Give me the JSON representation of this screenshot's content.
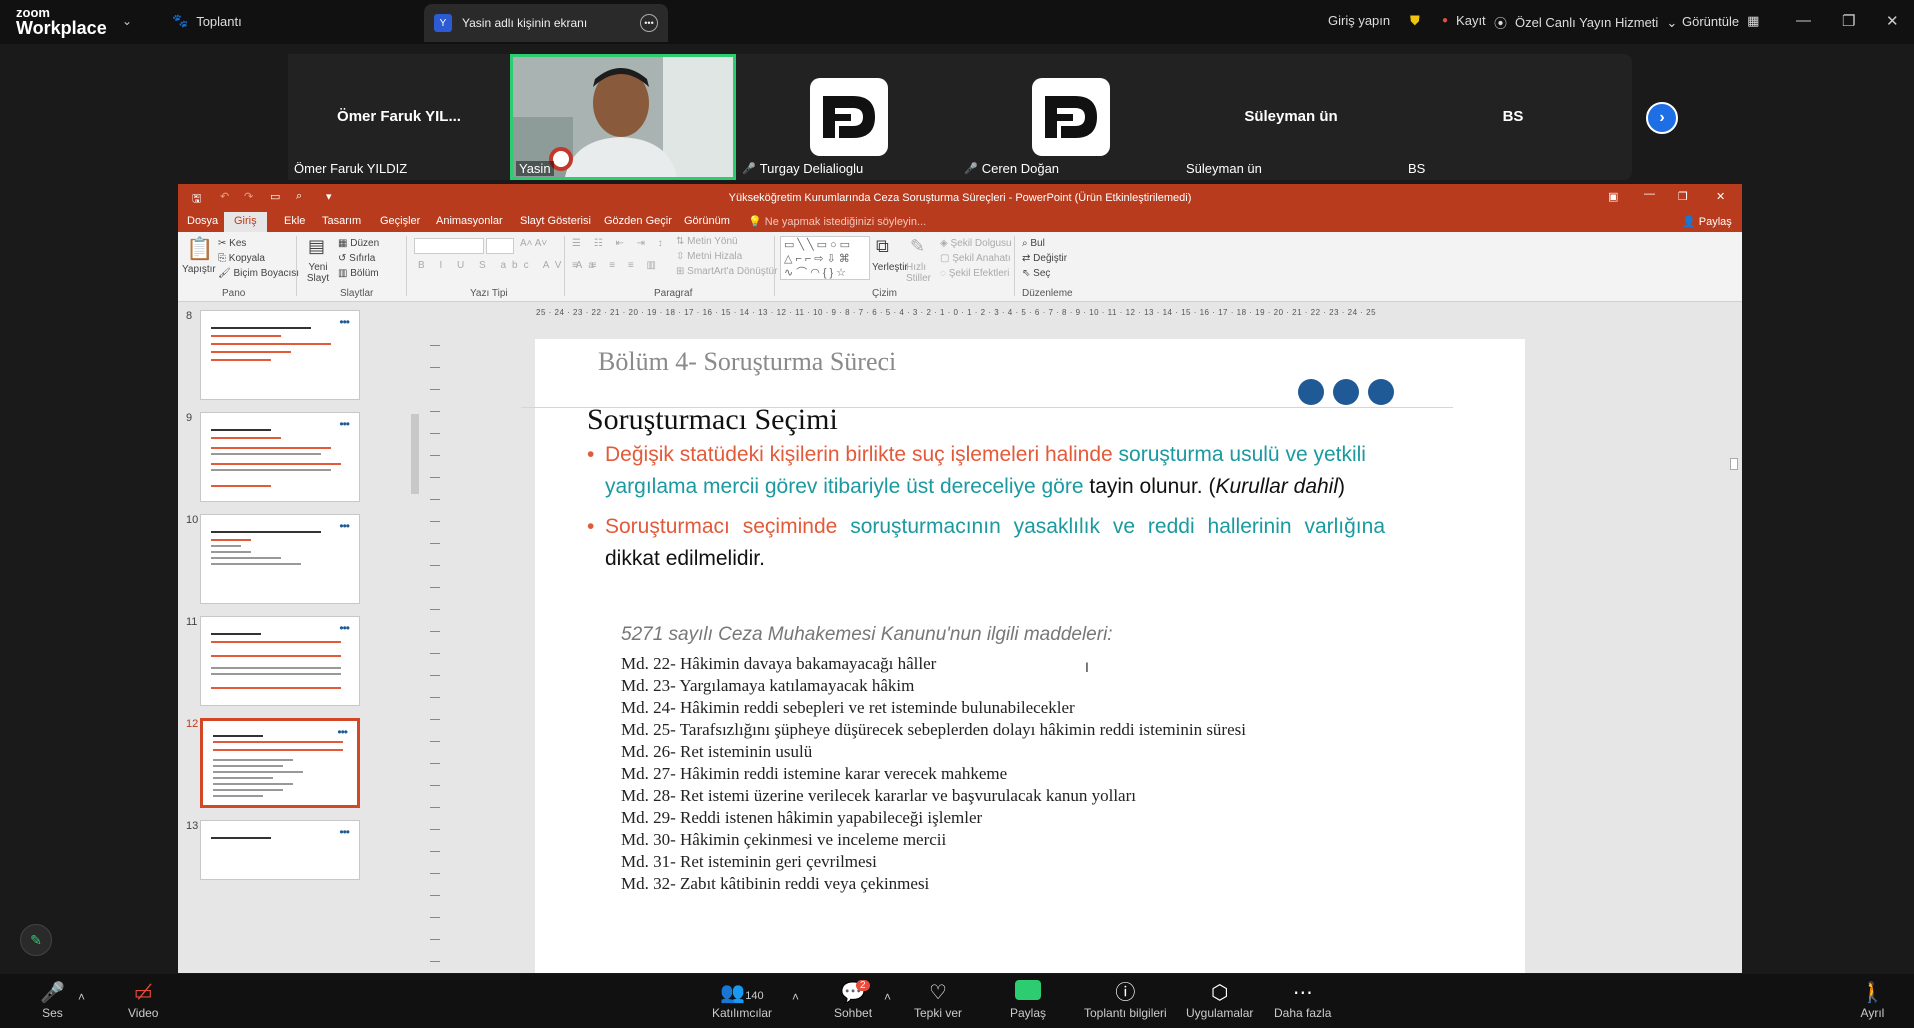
{
  "topbar": {
    "brand_top": "zoom",
    "brand_bottom": "Workplace",
    "meeting_label": "Toplantı",
    "screen_tab_letter": "Y",
    "screen_tab_label": "Yasin adlı kişinin ekranı",
    "login": "Giriş yapın",
    "record": "Kayıt",
    "live": "Özel Canlı Yayın Hizmeti",
    "view": "Görüntüle"
  },
  "gallery": [
    {
      "center": "Ömer Faruk YIL...",
      "bottom": "Ömer Faruk YILDIZ",
      "type": "name",
      "muted": false
    },
    {
      "center": "",
      "bottom": "Yasin",
      "type": "video",
      "muted": false
    },
    {
      "center": "",
      "bottom": "Turgay Delialioglu",
      "type": "logo",
      "muted": true
    },
    {
      "center": "",
      "bottom": "Ceren Doğan",
      "type": "logo",
      "muted": true
    },
    {
      "center": "Süleyman ün",
      "bottom": "Süleyman ün",
      "type": "name",
      "muted": false
    },
    {
      "center": "BS",
      "bottom": "BS",
      "type": "name",
      "muted": false
    }
  ],
  "ppt": {
    "window_title": "Yükseköğretim Kurumlarında Ceza Soruşturma Süreçleri - PowerPoint (Ürün Etkinleştirilemedi)",
    "tabs": [
      "Dosya",
      "Giriş",
      "Ekle",
      "Tasarım",
      "Geçişler",
      "Animasyonlar",
      "Slayt Gösterisi",
      "Gözden Geçir",
      "Görünüm"
    ],
    "tell_me": "Ne yapmak istediğinizi söyleyin...",
    "share": "Paylaş",
    "ribbon": {
      "paste": "Yapıştır",
      "cut": "Kes",
      "copy": "Kopyala",
      "format_painter": "Biçim Boyacısı",
      "clipboard": "Pano",
      "new_slide": "Yeni Slayt",
      "layout": "Düzen",
      "reset": "Sıfırla",
      "section": "Bölüm",
      "slides": "Slaytlar",
      "font_group": "Yazı Tipi",
      "text_direction": "Metin Yönü",
      "align_text": "Metni Hizala",
      "smartart": "SmartArt'a Dönüştür",
      "paragraph": "Paragraf",
      "arrange": "Yerleştir",
      "quick_styles": "Hızlı Stiller",
      "shape_fill": "Şekil Dolgusu",
      "shape_outline": "Şekil Anahatı",
      "shape_effects": "Şekil Efektleri",
      "drawing": "Çizim",
      "find": "Bul",
      "replace": "Değiştir",
      "select": "Seç",
      "editing": "Düzenleme"
    },
    "ruler": "25 · 24 · 23 · 22 · 21 · 20 · 19 · 18 · 17 · 16 · 15 · 14 · 13 · 12 · 11 · 10 · 9 · 8 · 7 · 6 · 5 · 4 · 3 · 2 · 1 · 0 · 1 · 2 · 3 · 4 · 5 · 6 · 7 · 8 · 9 · 10 · 11 · 12 · 13 · 14 · 15 · 16 · 17 · 18 · 19 · 20 · 21 · 22 · 23 · 24 · 25",
    "thumbnails": [
      {
        "num": "8",
        "selected": false
      },
      {
        "num": "9",
        "selected": false
      },
      {
        "num": "10",
        "selected": false
      },
      {
        "num": "11",
        "selected": false
      },
      {
        "num": "12",
        "selected": true
      },
      {
        "num": "13",
        "selected": false
      }
    ]
  },
  "slide": {
    "header": "Bölüm 4- Soruşturma Süreci",
    "title": "Soruşturmacı Seçimi",
    "b1_red": "Değişik statüdeki kişilerin birlikte suç işlemeleri halinde ",
    "b1_teal": "soruşturma usulü ve yetkili yargılama mercii görev itibariyle üst dereceliye göre",
    "b1_black": " tayin olunur. (",
    "b1_italic": "Kurullar dahil",
    "b1_end": ")",
    "b2_red": "Soruşturmacı seçiminde ",
    "b2_teal": "soruşturmacının yasaklılık ve reddi hallerinin varlığına",
    "b2_black": " dikkat edilmelidir.",
    "law_heading": "5271 sayılı Ceza Muhakemesi Kanunu'nun ilgili maddeleri:",
    "articles": [
      "Md. 22- Hâkimin davaya bakamayacağı hâller",
      "Md. 23- Yargılamaya katılamayacak hâkim",
      "Md. 24- Hâkimin reddi sebepleri ve ret isteminde bulunabilecekler",
      "Md. 25- Tarafsızlığını şüpheye düşürecek sebeplerden dolayı hâkimin reddi isteminin süresi",
      "Md. 26- Ret isteminin usulü",
      "Md. 27- Hâkimin reddi istemine karar verecek mahkeme",
      "Md. 28- Ret istemi üzerine verilecek kararlar ve başvurulacak kanun yolları",
      "Md. 29- Reddi istenen hâkimin yapabileceği işlemler",
      "Md. 30- Hâkimin çekinmesi ve inceleme mercii",
      "Md. 31- Ret isteminin geri çevrilmesi",
      "Md. 32- Zabıt kâtibinin reddi veya çekinmesi"
    ]
  },
  "bottombar": {
    "audio": "Ses",
    "video": "Video",
    "participants": "Katılımcılar",
    "participants_count": "140",
    "chat": "Sohbet",
    "chat_badge": "2",
    "reactions": "Tepki ver",
    "share": "Paylaş",
    "meeting_info": "Toplantı bilgileri",
    "apps": "Uygulamalar",
    "more": "Daha fazla",
    "leave": "Ayrıl"
  },
  "colors": {
    "ppt_accent": "#b83b1e",
    "slide_red": "#e35a3a",
    "slide_teal": "#1a9aa0",
    "slide_dots": "#1f5a96",
    "active_speaker": "#2ecc71"
  }
}
